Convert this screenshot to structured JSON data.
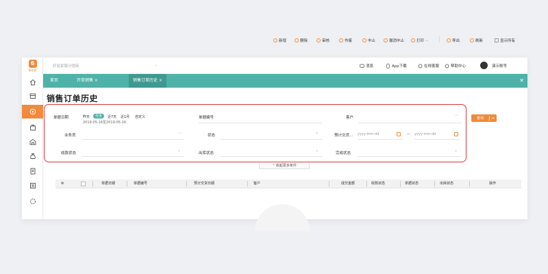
{
  "app": {
    "logo_text": "秘讯纸"
  },
  "topbar": {
    "store_placeholder": "好逛家服分销商",
    "messages": "消息",
    "app_download": "App下载",
    "online_support": "在线客服",
    "help_center": "帮助中心",
    "username": "演示账号"
  },
  "tabs": [
    {
      "label": "首页"
    },
    {
      "label": "开单销售 ×"
    },
    {
      "label": "销售订单历史 ×"
    }
  ],
  "page": {
    "title": "销售订单历史"
  },
  "toolbar": {
    "new": "新增",
    "delete": "删除",
    "audit": "审核",
    "void": "作废",
    "stop": "中止",
    "cancel_stop": "撤消中止",
    "print": "打印",
    "export": "导出",
    "refresh": "刷新",
    "show_hidden": "显示所有"
  },
  "filter": {
    "date_label": "单据日期",
    "quick_dates": [
      "昨天",
      "今天",
      "近7天",
      "近1月",
      "自定义"
    ],
    "date_range": "2019-05-16至2019-05-16",
    "doc_no_label": "单据编号",
    "customer_label": "客户",
    "salesman_label": "业务员",
    "status_label": "状态",
    "expected_date_label": "预计交货...",
    "date_placeholder_from": "yyyy-mm-dd",
    "date_placeholder_to": "yyyy-mm-dd",
    "range_dash": "—",
    "receipt_status_label": "收款状态",
    "outbound_status_label": "出库状态",
    "complete_status_label": "完成状态",
    "search_button": "查询",
    "dots": "⋯"
  },
  "collapse": {
    "label": "收起更多条件"
  },
  "table": {
    "columns": [
      "单据日期",
      "单据编号",
      "预计交货日期",
      "客户",
      "成交金额",
      "收款状态",
      "单据状态",
      "出库状态",
      "操作"
    ]
  }
}
